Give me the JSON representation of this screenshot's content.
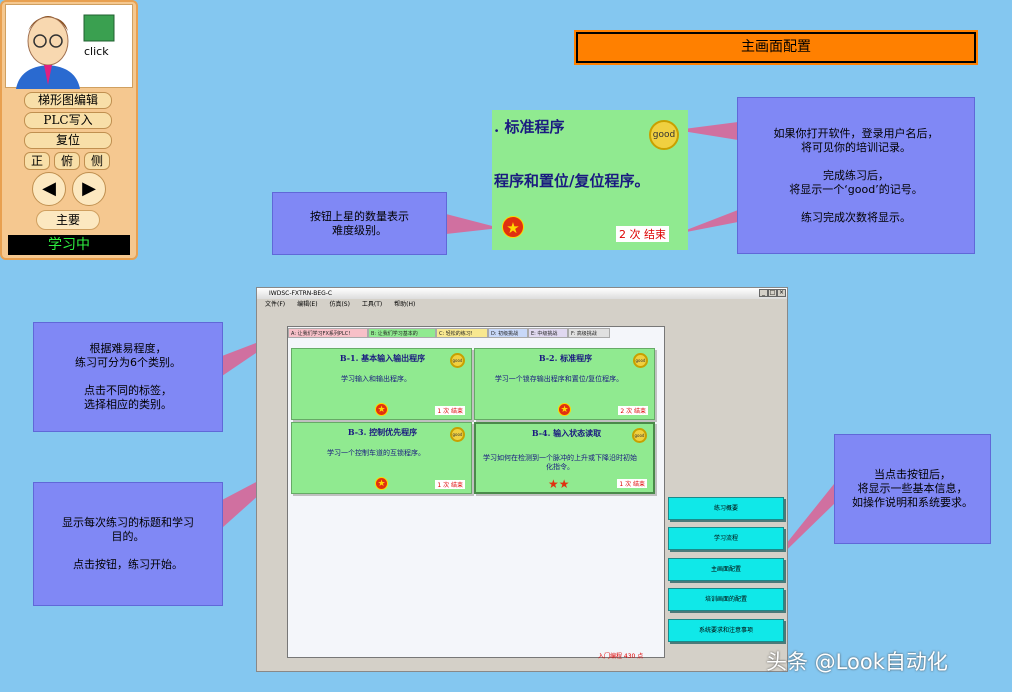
{
  "panel": {
    "click_label": "click",
    "buttons": [
      "梯形图编辑",
      "PLC写入",
      "复位"
    ],
    "views": [
      "正",
      "俯",
      "侧"
    ],
    "prev": "◀",
    "next": "▶",
    "main_label": "主要",
    "status": "学习中"
  },
  "header": {
    "title": "主画面配置"
  },
  "zoom": {
    "title1": ". 标准程序",
    "title2": "程序和置位/复位程序。",
    "medal": "good",
    "star": "★",
    "count_text": "2 次 结束"
  },
  "callouts": {
    "stars": [
      "按钮上星的数量表示",
      "难度级别。"
    ],
    "record": [
      "如果你打开软件，登录用户名后，",
      "将可见你的培训记录。",
      "",
      "完成练习后，",
      "将显示一个‘good’的记号。",
      "",
      "练习完成次数将显示。"
    ],
    "category": [
      "根据难易程度，",
      "练习可分为6个类别。",
      "",
      "点击不同的标签，",
      "选择相应的类别。"
    ],
    "exercise": [
      "显示每次练习的标题和学习",
      "目的。",
      "",
      "点击按钮，练习开始。"
    ],
    "info": [
      "当点击按钮后，",
      "将显示一些基本信息，",
      "如操作说明和系统要求。"
    ]
  },
  "window": {
    "title": "IWDSC-FXTRN-BEG-C",
    "menu": [
      "文件(F)",
      "编辑(E)",
      "仿真(S)",
      "工具(T)",
      "帮助(H)"
    ],
    "tabs": [
      "A: 让我们学习FX系列PLC!",
      "B: 让我们学习基本的",
      "C: 轻松的练习!",
      "D: 初级挑战",
      "E: 中级挑战",
      "F: 高级挑战"
    ],
    "cards": [
      {
        "title": "B-1. 基本输入输出程序",
        "desc": "学习输入和输出程序。",
        "count": "1 次 结束",
        "stars": "★"
      },
      {
        "title": "B-2. 标准程序",
        "desc": "学习一个锁存输出程序和置位/复位程序。",
        "count": "2 次 结束",
        "stars": "★"
      },
      {
        "title": "B-3. 控制优先程序",
        "desc": "学习一个控制车道的互锁程序。",
        "count": "1 次 结束",
        "stars": "★"
      },
      {
        "title": "B-4. 输入状态读取",
        "desc": "学习如何在检测到一个脉冲的上升或下降沿时初始化指令。",
        "count": "1 次 结束",
        "stars": "★★"
      }
    ],
    "side_buttons": [
      "练习概要",
      "学习流程",
      "主画面配置",
      "培训画面的配置",
      "系统要求和注意事项"
    ],
    "score": "入门编程  430 点"
  },
  "watermark": "头条 @Look自动化",
  "colors": {
    "background": "#84c7f0",
    "callout": "#8088f5",
    "arrow": "#d070a0",
    "card": "#90ea90",
    "accent": "#ff8000"
  }
}
